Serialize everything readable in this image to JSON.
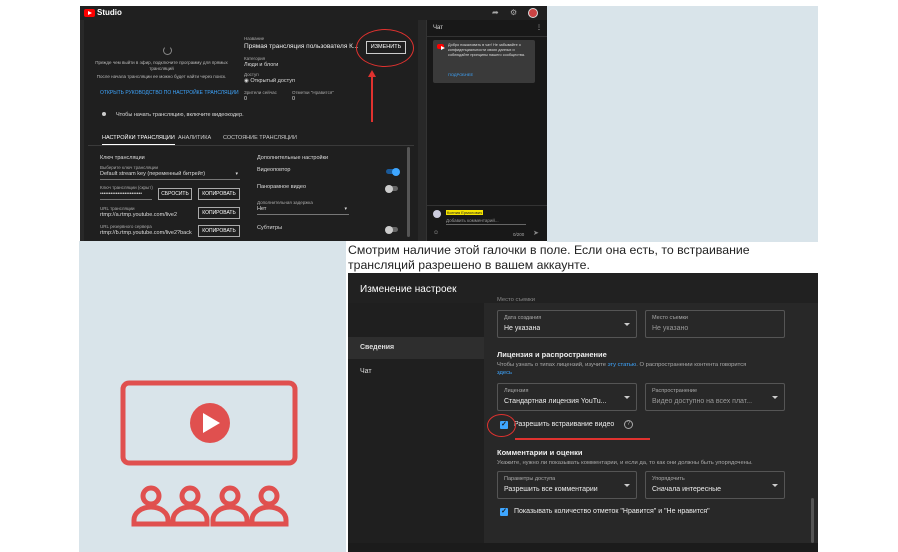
{
  "studio": {
    "brand": "Studio",
    "preview_text": "Прежде чем выйти в эфир, подключите программу для прямых трансляций",
    "preview_note": "После начала трансляции ее можно будет найти через поиск.",
    "preview_link": "ОТКРЫТЬ РУКОВОДСТВО ПО НАСТРОЙКЕ ТРАНСЛЯЦИИ",
    "title_label": "Название",
    "title_value": "Прямая трансляция пользователя К...",
    "category_label": "Категория",
    "category_value": "Люди и блоги",
    "access_label": "Доступ",
    "access_value": "Открытый доступ",
    "viewers_label": "Зрители сейчас",
    "viewers_value": "0",
    "likes_label": "Отметки \"Нравится\"",
    "likes_value": "0",
    "edit_button": "ИЗМЕНИТЬ",
    "encoder_msg": "Чтобы начать трансляцию, включите видеокодер.",
    "tabs": [
      "НАСТРОЙКИ ТРАНСЛЯЦИИ",
      "АНАЛИТИКА",
      "СОСТОЯНИЕ ТРАНСЛЯЦИИ"
    ],
    "key_section": "Ключ трансляции",
    "key_select_label": "Выберите ключ трансляции",
    "key_select_value": "Default stream key (переменный битрейт)",
    "key_label": "Ключ трансляции (скрыт)",
    "key_value": "••••••••••••••••••••••••",
    "reset_button": "СБРОСИТЬ",
    "copy_button": "КОПИРОВАТЬ",
    "url_label": "URL трансляции",
    "url_value": "rtmp://a.rtmp.youtube.com/live2",
    "backup_label": "URL резервного сервера",
    "backup_value": "rtmp://b.rtmp.youtube.com/live2?back",
    "adv_section": "Дополнительные настройки",
    "dvr": "Видеоповтор",
    "panorama": "Панорамное видео",
    "delay_label": "Дополнительная задержка",
    "delay_value": "Нет",
    "subtitles": "Субтитры",
    "chat_title": "Чат",
    "chat_msg": "Добро пожаловать в чат! Не забывайте о конфиденциальности своих данных и соблюдайте принципы нашего сообщества.",
    "chat_more": "ПОДРОБНЕЕ",
    "chat_user": "Ксения Ермолович",
    "chat_placeholder": "Добавить комментарий...",
    "chat_counter": "0/200"
  },
  "caption": "Смотрим наличие этой галочки в поле. Если она есть, то встраивание трансляций разрешено в вашем аккаунте.",
  "settings": {
    "header": "Изменение настроек",
    "side_items": [
      "Сведения",
      "Чат"
    ],
    "location_cut": "Место съемки",
    "date_label": "Дата создания",
    "date_value": "Не указана",
    "place_label": "Место съемки",
    "place_value": "Не указано",
    "license_title": "Лицензия и распространение",
    "license_desc_1": "Чтобы узнать о типах лицензий, изучите ",
    "license_link": "эту статью",
    "license_desc_2": ". О распространении контента говорится",
    "license_desc_link": "здесь",
    "license_label": "Лицензия",
    "license_value": "Стандартная лицензия YouTu...",
    "distrib_label": "Распространение",
    "distrib_value": "Видео доступно на всех плат...",
    "allow_embed": "Разрешить встраивание видео",
    "comments_title": "Комментарии и оценки",
    "comments_desc": "Укажите, нужно ли показывать комментарии, и если да, то как они должны быть упорядочены.",
    "access_label": "Параметры доступа",
    "access_value": "Разрешить все комментарии",
    "sort_label": "Упорядочить",
    "sort_value": "Сначала интересные",
    "show_likes": "Показывать количество отметок \"Нравится\" и \"Не нравится\""
  },
  "colors": {
    "accent_red": "#e0322f",
    "illus_red": "#e0504f",
    "checkbox_blue": "#3ea6ff",
    "light_bg": "#d9e4ea"
  }
}
